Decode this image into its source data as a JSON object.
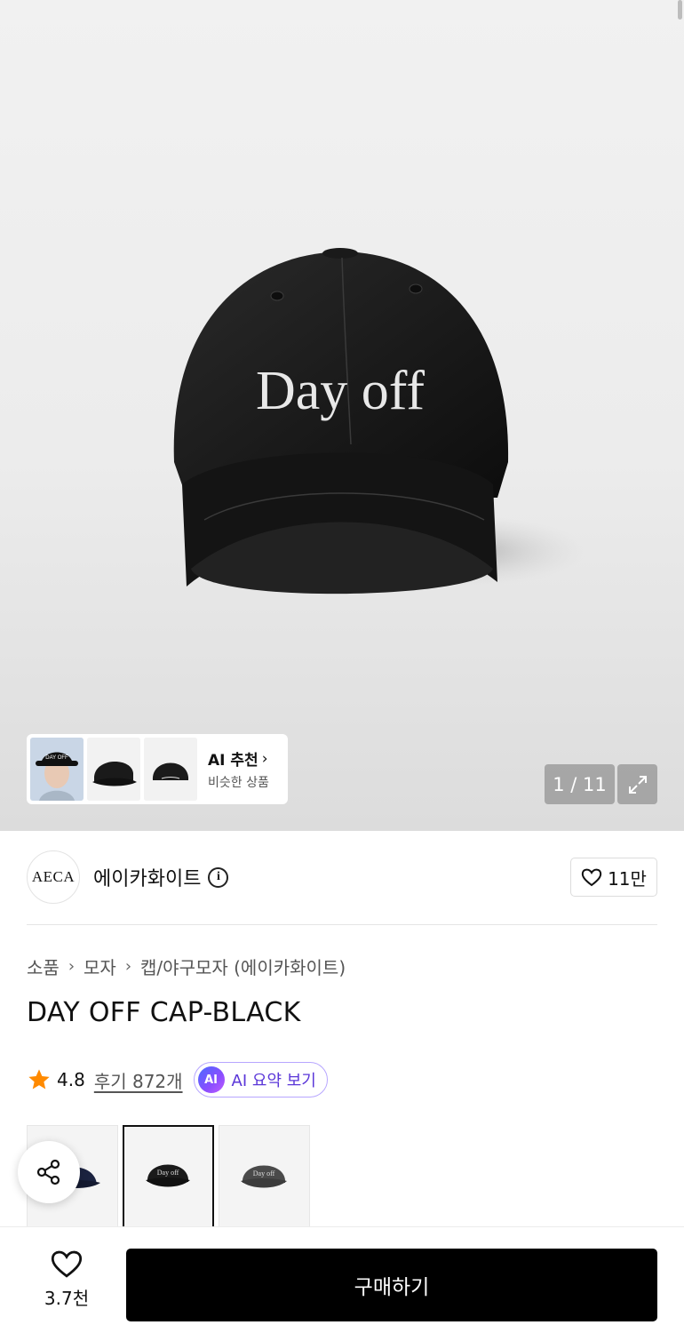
{
  "gallery": {
    "counter": "1 / 11",
    "product_text": "Day off",
    "ai_recommend": {
      "title": "AI 추천",
      "subtitle": "비슷한 상품"
    },
    "ai_thumb_text": "DAY OFF"
  },
  "brand": {
    "logo_text": "AECA",
    "name": "에이카화이트",
    "like_count": "11만"
  },
  "breadcrumb": [
    "소품",
    "모자",
    "캡/야구모자 (에이카화이트)"
  ],
  "product": {
    "title": "DAY OFF CAP-BLACK"
  },
  "rating": {
    "value": "4.8",
    "reviews": "후기 872개",
    "ai_badge": "AI",
    "ai_summary": "AI 요약 보기"
  },
  "bottom_bar": {
    "wish_count": "3.7천",
    "buy_label": "구매하기"
  },
  "colors": {
    "accent_star": "#ff8a00",
    "ai_purple": "#5a36d8",
    "buy_button": "#000000"
  }
}
